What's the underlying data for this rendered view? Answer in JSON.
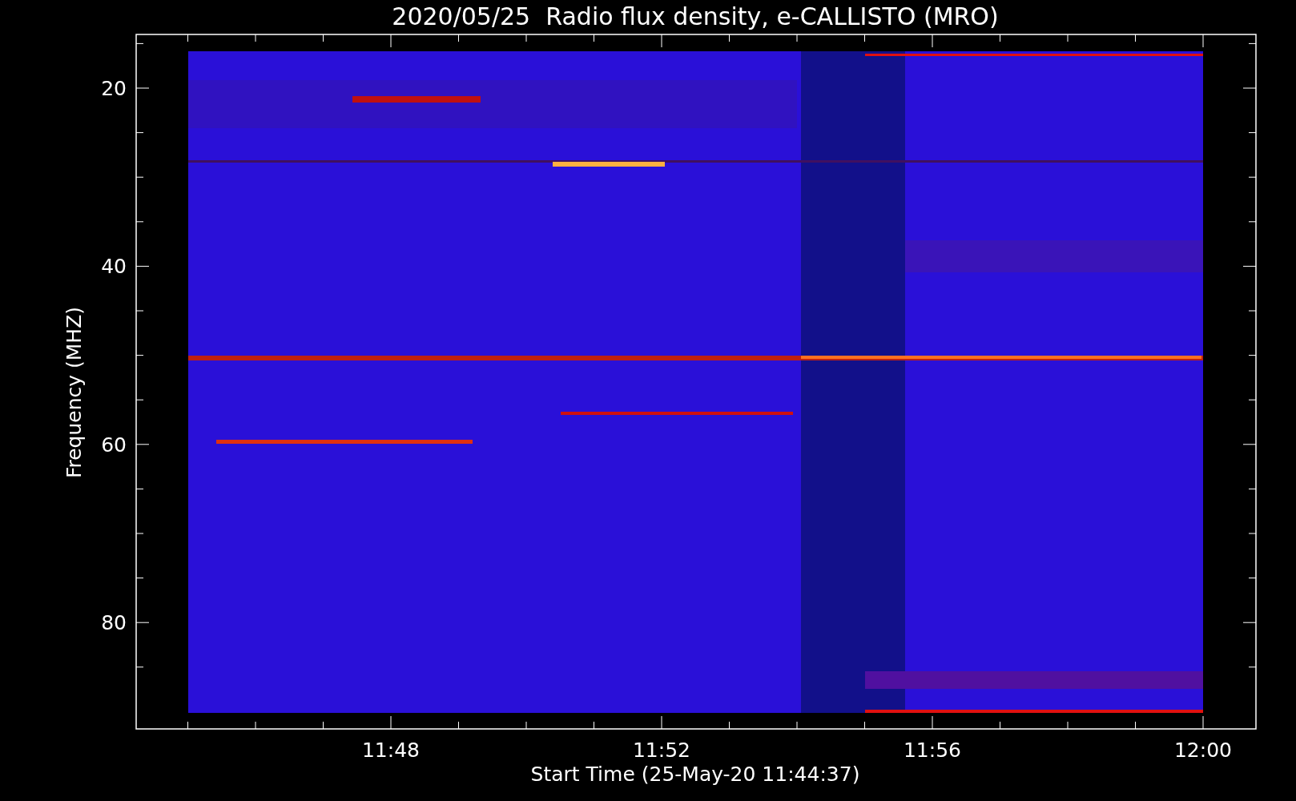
{
  "title": "2020/05/25  Radio flux density, e-CALLISTO (MRO)",
  "y_axis": {
    "label": "Frequency (MHZ)",
    "ticks": [
      "20",
      "40",
      "60",
      "80"
    ]
  },
  "x_axis": {
    "label": "Start Time (25-May-20 11:44:37)",
    "ticks": [
      "11:48",
      "11:52",
      "11:56",
      "12:00"
    ]
  }
}
